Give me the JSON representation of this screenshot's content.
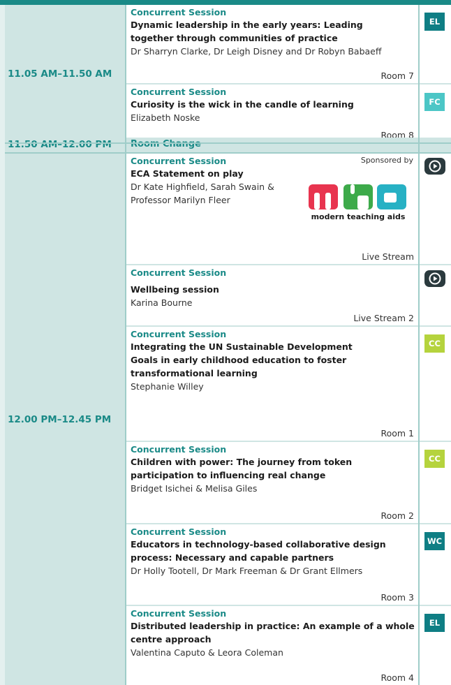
{
  "times": {
    "slot1": "11.05 AM–11.50 AM",
    "slot2": "11.50 AM–12.00 PM",
    "slot3": "12.00 PM–12.45 PM"
  },
  "room_change": "Room Change",
  "sponsor": {
    "label": "Sponsored by",
    "tagline": "modern teaching aids",
    "colors": {
      "m": "#e8344f",
      "t": "#3daa4a",
      "a": "#27b1c4"
    }
  },
  "sessions": [
    {
      "kind": "Concurrent Session",
      "title": "Dynamic leadership in the early years: Leading together through communities of practice",
      "speakers": "Dr Sharryn Clarke, Dr Leigh Disney and Dr Robyn Babaeff",
      "room": "Room 7",
      "tag": "EL"
    },
    {
      "kind": "Concurrent Session",
      "title": "Curiosity is the wick in the candle of learning",
      "speakers": "Elizabeth Noske",
      "room": "Room 8",
      "tag": "FC"
    },
    {
      "kind": "Concurrent Session",
      "title": "ECA Statement on play",
      "speakers": "Dr Kate Highfield, Sarah Swain & Professor Marilyn Fleer",
      "room": "Live Stream",
      "tag": "play-icon"
    },
    {
      "kind": "Concurrent Session",
      "title": "Wellbeing session",
      "speakers": "Karina Bourne",
      "room": "Live Stream 2",
      "tag": "play-icon"
    },
    {
      "kind": "Concurrent Session",
      "title": "Integrating the UN Sustainable Development Goals in early childhood education to foster transformational learning",
      "speakers": "Stephanie Willey",
      "room": "Room 1",
      "tag": "CC"
    },
    {
      "kind": "Concurrent Session",
      "title": "Children with power: The journey from token participation to influencing real change",
      "speakers": "Bridget Isichei & Melisa Giles",
      "room": "Room 2",
      "tag": "CC"
    },
    {
      "kind": "Concurrent Session",
      "title": "Educators in technology-based collaborative design process: Necessary and capable partners",
      "speakers": "Dr Holly Tootell, Dr Mark Freeman & Dr Grant Ellmers",
      "room": "Room 3",
      "tag": "WC"
    },
    {
      "kind": "Concurrent Session",
      "title": "Distributed leadership in practice: An example of a whole centre approach",
      "speakers": "Valentina Caputo & Leora Coleman",
      "room": "Room 4",
      "tag": "EL"
    }
  ],
  "colors": {
    "teal": "#1a8a87",
    "light_teal": "#cfe5e3",
    "el": "#0f7e84",
    "fc": "#4cc6c6",
    "cc": "#b5d33d",
    "play": "#2b3a3e"
  }
}
